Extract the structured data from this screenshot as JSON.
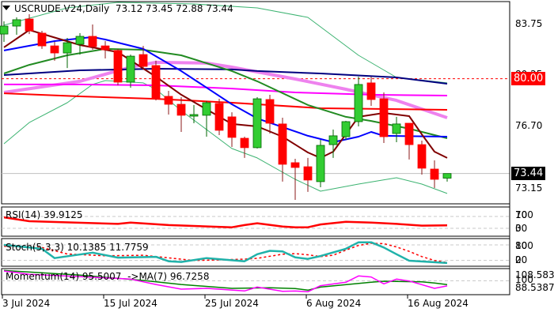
{
  "header": {
    "symbol": "USCRUDE.V24,Daily",
    "ohlc": "73.12 73.45 72.88 73.44",
    "menu_icon": "triangle-down-icon"
  },
  "colors": {
    "bull": "#32CD32",
    "bear": "#FF0000",
    "level_80": "#FF0000",
    "last_price_bg": "#000000"
  },
  "price_axis": {
    "ticks": [
      "83.75",
      "80.25",
      "76.70",
      "73.15"
    ],
    "level_tag": "80.00",
    "last_tag": "73.44"
  },
  "panels": {
    "rsi": {
      "label": "RSI(14) 39.9125",
      "ticks": [
        "100",
        "70",
        "30",
        "0"
      ]
    },
    "stoch": {
      "label": "Stoch(5,3,3) 10.1385 11.7759",
      "ticks": [
        "100",
        "80",
        "20",
        "0"
      ]
    },
    "momentum": {
      "label": "Momentum(14) 95.5007  ->MA(7) 96.7258",
      "ticks": [
        "108.583",
        "100",
        "88.5387"
      ]
    }
  },
  "x_axis": {
    "labels": [
      "3 Jul 2024",
      "15 Jul 2024",
      "25 Jul 2024",
      "6 Aug 2024",
      "16 Aug 2024"
    ]
  },
  "chart_data": {
    "type": "candlestick",
    "title": "USCRUDE.V24,Daily",
    "ylim": [
      71.5,
      85.5
    ],
    "horizontal_levels": [
      80.0,
      73.44
    ],
    "candles": [
      [
        "3 Jul",
        83.09,
        83.97,
        82.55,
        83.64
      ],
      [
        "4 Jul",
        83.64,
        84.24,
        83.04,
        84.08
      ],
      [
        "5 Jul",
        84.13,
        84.46,
        83.09,
        83.31
      ],
      [
        "8 Jul",
        83.15,
        83.31,
        82.06,
        82.27
      ],
      [
        "9 Jul",
        82.27,
        82.55,
        81.24,
        81.78
      ],
      [
        "10 Jul",
        81.78,
        82.82,
        80.74,
        82.49
      ],
      [
        "11 Jul",
        82.38,
        83.15,
        81.67,
        82.93
      ],
      [
        "12 Jul",
        82.93,
        83.75,
        82.0,
        82.22
      ],
      [
        "15 Jul",
        82.27,
        82.6,
        81.4,
        82.0
      ],
      [
        "16 Jul",
        81.95,
        82.06,
        79.54,
        79.76
      ],
      [
        "17 Jul",
        79.76,
        81.67,
        79.38,
        81.56
      ],
      [
        "18 Jul",
        81.67,
        82.27,
        80.64,
        80.85
      ],
      [
        "19 Jul",
        80.91,
        81.24,
        78.5,
        78.61
      ],
      [
        "22 Jul",
        78.78,
        79.16,
        77.52,
        78.23
      ],
      [
        "23 Jul",
        78.23,
        78.72,
        76.32,
        77.47
      ],
      [
        "24 Jul",
        77.41,
        78.18,
        76.92,
        77.52
      ],
      [
        "25 Jul",
        77.47,
        78.45,
        75.99,
        78.34
      ],
      [
        "26 Jul",
        78.29,
        78.61,
        76.1,
        76.43
      ],
      [
        "29 Jul",
        77.36,
        77.68,
        75.28,
        75.94
      ],
      [
        "30 Jul",
        75.88,
        75.99,
        74.52,
        75.23
      ],
      [
        "31 Jul",
        75.23,
        78.72,
        75.17,
        78.61
      ],
      [
        "1 Aug",
        78.56,
        78.89,
        76.21,
        76.92
      ],
      [
        "2 Aug",
        76.87,
        77.3,
        72.88,
        74.08
      ],
      [
        "5 Aug",
        74.19,
        74.46,
        71.62,
        73.86
      ],
      [
        "6 Aug",
        73.91,
        74.52,
        72.17,
        72.99
      ],
      [
        "7 Aug",
        72.88,
        75.77,
        72.49,
        75.39
      ],
      [
        "8 Aug",
        75.44,
        76.48,
        74.52,
        76.05
      ],
      [
        "9 Aug",
        75.99,
        77.08,
        75.77,
        77.03
      ],
      [
        "12 Aug",
        77.03,
        80.14,
        76.7,
        79.6
      ],
      [
        "13 Aug",
        79.71,
        80.14,
        78.12,
        78.56
      ],
      [
        "14 Aug",
        78.61,
        79.05,
        75.55,
        75.99
      ],
      [
        "15 Aug",
        76.21,
        77.36,
        75.61,
        76.87
      ],
      [
        "16 Aug",
        76.92,
        76.92,
        74.41,
        75.44
      ],
      [
        "19 Aug",
        75.44,
        75.72,
        73.37,
        73.81
      ],
      [
        "20 Aug",
        73.75,
        74.35,
        72.44,
        73.04
      ],
      [
        "21 Aug",
        73.12,
        73.45,
        72.88,
        73.44
      ]
    ],
    "overlays": [
      {
        "color": "#3CB371",
        "width": 1,
        "points": [
          [
            "3 Jul",
            83.7
          ],
          [
            "10 Jul",
            84.9
          ],
          [
            "16 Jul",
            85.28
          ],
          [
            "24 Jul",
            85.17
          ],
          [
            "31 Jul",
            84.9
          ],
          [
            "6 Aug",
            84.24
          ],
          [
            "12 Aug",
            81.62
          ],
          [
            "15 Aug",
            80.09
          ],
          [
            "21 Aug",
            79.71
          ]
        ]
      },
      {
        "color": "#3CB371",
        "width": 1,
        "points": [
          [
            "3 Jul",
            75.5
          ],
          [
            "5 Jul",
            76.97
          ],
          [
            "10 Jul",
            78.34
          ],
          [
            "12 Jul",
            79.6
          ],
          [
            "15 Jul",
            79.87
          ],
          [
            "18 Jul",
            79.71
          ],
          [
            "19 Jul",
            79.27
          ],
          [
            "23 Jul",
            77.79
          ],
          [
            "29 Jul",
            75.17
          ],
          [
            "31 Jul",
            74.52
          ],
          [
            "5 Aug",
            73.04
          ],
          [
            "7 Aug",
            72.22
          ],
          [
            "12 Aug",
            72.71
          ],
          [
            "15 Aug",
            73.15
          ],
          [
            "19 Aug",
            72.71
          ],
          [
            "21 Aug",
            72.06
          ]
        ]
      },
      {
        "color": "#EE82EE",
        "width": 4,
        "points": [
          [
            "3 Jul",
            79.05
          ],
          [
            "11 Jul",
            79.82
          ],
          [
            "17 Jul",
            80.8
          ],
          [
            "19 Jul",
            81.13
          ],
          [
            "25 Jul",
            81.08
          ],
          [
            "29 Jul",
            80.8
          ],
          [
            "5 Aug",
            79.98
          ],
          [
            "9 Aug",
            79.27
          ],
          [
            "15 Aug",
            78.5
          ],
          [
            "21 Aug",
            77.3
          ]
        ]
      },
      {
        "color": "#FF00FF",
        "width": 2,
        "points": [
          [
            "3 Jul",
            79.6
          ],
          [
            "11 Jul",
            79.6
          ],
          [
            "19 Jul",
            79.54
          ],
          [
            "29 Jul",
            79.32
          ],
          [
            "5 Aug",
            79.05
          ],
          [
            "13 Aug",
            78.89
          ],
          [
            "21 Aug",
            78.83
          ]
        ]
      },
      {
        "color": "#FF0000",
        "width": 2,
        "points": [
          [
            "3 Jul",
            78.99
          ],
          [
            "11 Jul",
            78.78
          ],
          [
            "19 Jul",
            78.61
          ],
          [
            "29 Jul",
            78.34
          ],
          [
            "7 Aug",
            77.96
          ],
          [
            "21 Aug",
            77.85
          ]
        ]
      },
      {
        "color": "#000080",
        "width": 2,
        "points": [
          [
            "3 Jul",
            80.25
          ],
          [
            "11 Jul",
            80.58
          ],
          [
            "19 Jul",
            80.69
          ],
          [
            "29 Jul",
            80.64
          ],
          [
            "31 Jul",
            80.53
          ],
          [
            "7 Aug",
            80.36
          ],
          [
            "15 Aug",
            80.09
          ],
          [
            "21 Aug",
            79.65
          ]
        ]
      },
      {
        "color": "#228B22",
        "width": 2,
        "points": [
          [
            "3 Jul",
            80.36
          ],
          [
            "5 Jul",
            80.96
          ],
          [
            "10 Jul",
            81.62
          ],
          [
            "15 Jul",
            82.06
          ],
          [
            "18 Jul",
            82.0
          ],
          [
            "23 Jul",
            81.62
          ],
          [
            "29 Jul",
            80.53
          ],
          [
            "31 Jul",
            79.82
          ],
          [
            "6 Aug",
            78.18
          ],
          [
            "9 Aug",
            77.36
          ],
          [
            "13 Aug",
            77.08
          ],
          [
            "16 Aug",
            76.54
          ],
          [
            "21 Aug",
            75.88
          ]
        ]
      },
      {
        "color": "#0000FF",
        "width": 2,
        "points": [
          [
            "3 Jul",
            81.95
          ],
          [
            "9 Jul",
            82.6
          ],
          [
            "12 Jul",
            82.88
          ],
          [
            "15 Jul",
            82.71
          ],
          [
            "18 Jul",
            82.06
          ],
          [
            "23 Jul",
            80.53
          ],
          [
            "29 Jul",
            78.23
          ],
          [
            "31 Jul",
            77.25
          ],
          [
            "6 Aug",
            76.05
          ],
          [
            "8 Aug",
            75.61
          ],
          [
            "12 Aug",
            75.99
          ],
          [
            "13 Aug",
            76.32
          ],
          [
            "14 Aug",
            76.05
          ],
          [
            "21 Aug",
            75.99
          ]
        ]
      },
      {
        "color": "#800000",
        "width": 2,
        "points": [
          [
            "3 Jul",
            82.17
          ],
          [
            "5 Jul",
            83.37
          ],
          [
            "11 Jul",
            82.33
          ],
          [
            "16 Jul",
            81.84
          ],
          [
            "19 Jul",
            80.14
          ],
          [
            "23 Jul",
            78.89
          ],
          [
            "29 Jul",
            76.87
          ],
          [
            "31 Jul",
            76.7
          ],
          [
            "2 Aug",
            75.99
          ],
          [
            "6 Aug",
            74.9
          ],
          [
            "7 Aug",
            74.52
          ],
          [
            "8 Aug",
            74.95
          ],
          [
            "12 Aug",
            77.36
          ],
          [
            "14 Aug",
            77.63
          ],
          [
            "16 Aug",
            77.41
          ],
          [
            "19 Aug",
            76.15
          ],
          [
            "20 Aug",
            74.95
          ],
          [
            "21 Aug",
            74.52
          ]
        ]
      }
    ],
    "rsi": {
      "levels": [
        70,
        30
      ],
      "points": [
        [
          "3 Jul",
          67
        ],
        [
          "5 Jul",
          54
        ],
        [
          "16 Jul",
          45
        ],
        [
          "17 Jul",
          49.5
        ],
        [
          "22 Jul",
          41
        ],
        [
          "29 Jul",
          33.5
        ],
        [
          "30 Jul",
          41
        ],
        [
          "31 Jul",
          47
        ],
        [
          "2 Aug",
          36
        ],
        [
          "5 Aug",
          33.5
        ],
        [
          "6 Aug",
          33.5
        ],
        [
          "7 Aug",
          43
        ],
        [
          "9 Aug",
          52
        ],
        [
          "13 Aug",
          49.5
        ],
        [
          "15 Aug",
          45
        ],
        [
          "19 Aug",
          39
        ],
        [
          "21 Aug",
          39.91
        ]
      ]
    },
    "stoch": {
      "levels": [
        80,
        20
      ],
      "main": [
        [
          "3 Jul",
          80
        ],
        [
          "8 Jul",
          65
        ],
        [
          "9 Jul",
          29
        ],
        [
          "12 Jul",
          50
        ],
        [
          "16 Jul",
          31
        ],
        [
          "19 Jul",
          34
        ],
        [
          "22 Jul",
          17
        ],
        [
          "23 Jul",
          14
        ],
        [
          "25 Jul",
          29
        ],
        [
          "30 Jul",
          17
        ],
        [
          "31 Jul",
          44
        ],
        [
          "1 Aug",
          57
        ],
        [
          "2 Aug",
          55
        ],
        [
          "5 Aug",
          32
        ],
        [
          "6 Aug",
          26
        ],
        [
          "7 Aug",
          37
        ],
        [
          "9 Aug",
          65
        ],
        [
          "12 Aug",
          90
        ],
        [
          "13 Aug",
          90
        ],
        [
          "14 Aug",
          70
        ],
        [
          "15 Aug",
          44
        ],
        [
          "16 Aug",
          19
        ],
        [
          "21 Aug",
          10.14
        ]
      ],
      "signal": [
        [
          "3 Jul",
          75
        ],
        [
          "8 Jul",
          70
        ],
        [
          "10 Jul",
          45
        ],
        [
          "15 Jul",
          38
        ],
        [
          "18 Jul",
          40
        ],
        [
          "22 Jul",
          30
        ],
        [
          "24 Jul",
          20
        ],
        [
          "26 Jul",
          22
        ],
        [
          "30 Jul",
          25
        ],
        [
          "31 Jul",
          28
        ],
        [
          "2 Aug",
          44
        ],
        [
          "5 Aug",
          46
        ],
        [
          "6 Aug",
          42
        ],
        [
          "7 Aug",
          35
        ],
        [
          "8 Aug",
          40
        ],
        [
          "9 Aug",
          60
        ],
        [
          "12 Aug",
          78
        ],
        [
          "13 Aug",
          86
        ],
        [
          "14 Aug",
          85
        ],
        [
          "15 Aug",
          72
        ],
        [
          "16 Aug",
          55
        ],
        [
          "19 Aug",
          35
        ],
        [
          "20 Aug",
          20
        ],
        [
          "21 Aug",
          11.78
        ]
      ]
    },
    "momentum": {
      "levels": [
        100
      ],
      "range": [
        88.5387,
        108.583
      ],
      "main": [
        [
          "3 Jul",
          108.5
        ],
        [
          "4 Jul",
          107.2
        ],
        [
          "5 Jul",
          105.6
        ],
        [
          "11 Jul",
          103.7
        ],
        [
          "17 Jul",
          101.5
        ],
        [
          "19 Jul",
          96.8
        ],
        [
          "23 Jul",
          92.7
        ],
        [
          "25 Jul",
          93.4
        ],
        [
          "30 Jul",
          91.1
        ],
        [
          "31 Jul",
          94.5
        ],
        [
          "2 Aug",
          90.8
        ],
        [
          "5 Aug",
          91.0
        ],
        [
          "6 Aug",
          90.4
        ],
        [
          "7 Aug",
          95.7
        ],
        [
          "9 Aug",
          98.7
        ],
        [
          "12 Aug",
          104.2
        ],
        [
          "13 Aug",
          103.3
        ],
        [
          "14 Aug",
          97.3
        ],
        [
          "15 Aug",
          101.5
        ],
        [
          "16 Aug",
          99.8
        ],
        [
          "20 Aug",
          93.4
        ],
        [
          "21 Aug",
          95.5007
        ]
      ],
      "ma": [
        [
          "3 Jul",
          109.0
        ],
        [
          "11 Jul",
          104.9
        ],
        [
          "18 Jul",
          100.3
        ],
        [
          "23 Jul",
          96.8
        ],
        [
          "29 Jul",
          93.4
        ],
        [
          "1 Aug",
          93.9
        ],
        [
          "5 Aug",
          93.2
        ],
        [
          "6 Aug",
          91.8
        ],
        [
          "7 Aug",
          94.5
        ],
        [
          "13 Aug",
          98.7
        ],
        [
          "14 Aug",
          99.6
        ],
        [
          "19 Aug",
          99.1
        ],
        [
          "20 Aug",
          98.0
        ],
        [
          "21 Aug",
          96.7258
        ]
      ]
    }
  }
}
